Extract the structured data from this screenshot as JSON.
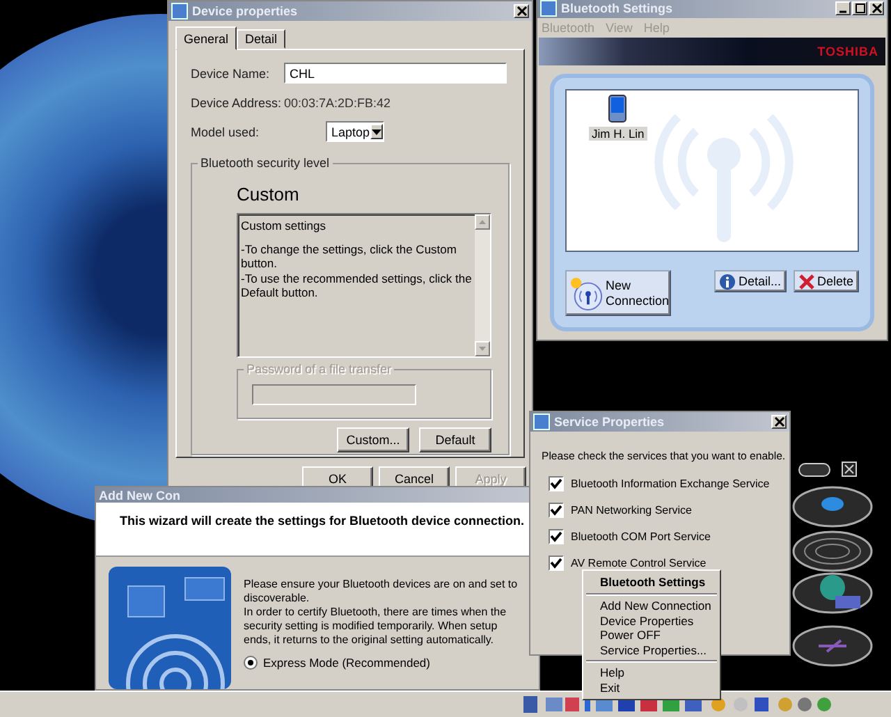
{
  "device_properties": {
    "title": "Device properties",
    "tabs": [
      {
        "label": "General",
        "selected": true
      },
      {
        "label": "Detail",
        "selected": false
      }
    ],
    "device_name_label": "Device Name:",
    "device_name": "CHL",
    "device_address_label": "Device Address:",
    "device_address": "00:03:7A:2D:FB:42",
    "model_label": "Model used:",
    "model": "Laptop",
    "security_group": "Bluetooth security level",
    "security_level": "Custom",
    "description": [
      "Custom settings",
      "-To change the settings, click the Custom button.\n-To use the recommended settings, click the Default button."
    ],
    "password": {
      "label": "Password of a file transfer",
      "disabled": true
    },
    "level_buttons": [
      {
        "label": "Custom...",
        "disabled": false
      },
      {
        "label": "Default",
        "disabled": false
      }
    ],
    "footer_buttons": [
      {
        "label": "OK",
        "disabled": false
      },
      {
        "label": "Cancel",
        "disabled": false
      },
      {
        "label": "Apply",
        "disabled": true
      }
    ]
  },
  "bluetooth_settings": {
    "title": "Bluetooth Settings",
    "menu": [
      "Bluetooth",
      "View",
      "Help"
    ],
    "brand": "TOSHIBA",
    "devices": [
      {
        "name": "Jim H. Lin",
        "selected": true
      }
    ],
    "new_connection": "New Connection",
    "buttons": [
      "Detail...",
      "Delete"
    ]
  },
  "wizard": {
    "title": "Add New Con",
    "heading": "This wizard will create the settings for Bluetooth device connection.",
    "paragraphs": [
      "Please ensure your Bluetooth devices are on and set to discoverable.",
      "In order to certify Bluetooth, there are times when the security setting is modified temporarily. When setup ends, it returns to the original setting automatically."
    ],
    "options": [
      {
        "label": "Express Mode (Recommended)",
        "selected": true
      }
    ]
  },
  "service_properties": {
    "title": "Service Properties",
    "prompt": "Please check the services that you want to enable.",
    "services": [
      {
        "label": "Bluetooth Information Exchange Service",
        "checked": true
      },
      {
        "label": "PAN Networking Service",
        "checked": true
      },
      {
        "label": "Bluetooth COM Port Service",
        "checked": true
      },
      {
        "label": "AV Remote Control Service",
        "checked": true
      }
    ]
  },
  "context_menu": {
    "title": "Bluetooth Settings",
    "groups": [
      [
        "Add New Connection",
        "Device Properties",
        "Power OFF",
        "Service Properties..."
      ],
      [
        "Help",
        "Exit"
      ]
    ]
  }
}
